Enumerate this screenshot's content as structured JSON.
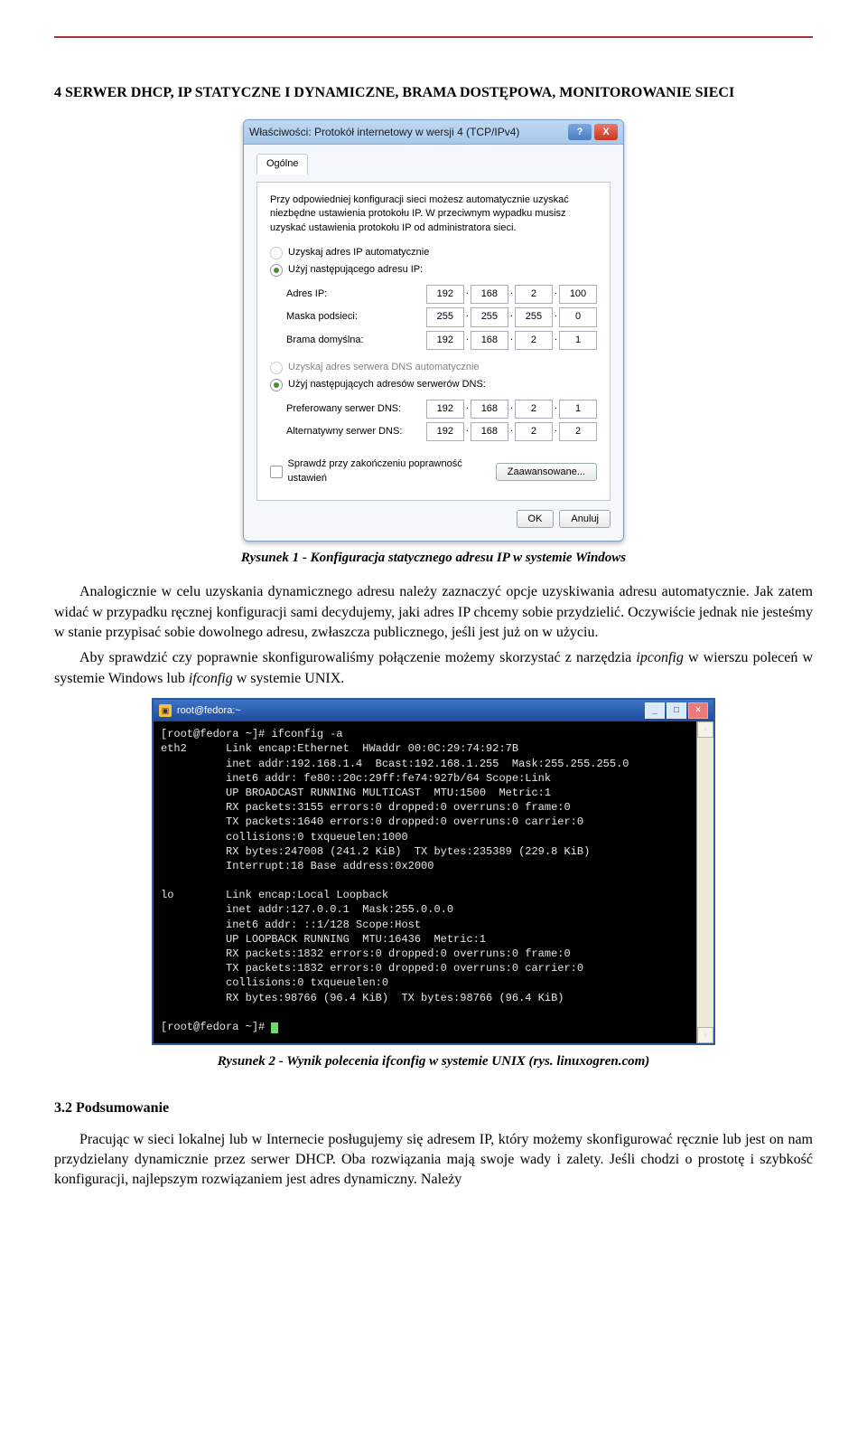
{
  "header_rule": true,
  "section_heading": "4   SERWER DHCP, IP STATYCZNE I DYNAMICZNE, BRAMA DOSTĘPOWA, MONITOROWANIE SIECI",
  "dialog": {
    "title": "Właściwości: Protokół internetowy w wersji 4 (TCP/IPv4)",
    "help_icon": "?",
    "close_icon": "X",
    "tab_label": "Ogólne",
    "description": "Przy odpowiedniej konfiguracji sieci możesz automatycznie uzyskać niezbędne ustawienia protokołu IP. W przeciwnym wypadku musisz uzyskać ustawienia protokołu IP od administratora sieci.",
    "radio_ip_auto": "Uzyskaj adres IP automatycznie",
    "radio_ip_manual": "Użyj następującego adresu IP:",
    "label_ip": "Adres IP:",
    "ip": [
      "192",
      "168",
      "2",
      "100"
    ],
    "label_mask": "Maska podsieci:",
    "mask": [
      "255",
      "255",
      "255",
      "0"
    ],
    "label_gateway": "Brama domyślna:",
    "gateway": [
      "192",
      "168",
      "2",
      "1"
    ],
    "radio_dns_auto": "Uzyskaj adres serwera DNS automatycznie",
    "radio_dns_manual": "Użyj następujących adresów serwerów DNS:",
    "label_dns_pref": "Preferowany serwer DNS:",
    "dns_pref": [
      "192",
      "168",
      "2",
      "1"
    ],
    "label_dns_alt": "Alternatywny serwer DNS:",
    "dns_alt": [
      "192",
      "168",
      "2",
      "2"
    ],
    "check_validate": "Sprawdź przy zakończeniu poprawność ustawień",
    "btn_advanced": "Zaawansowane...",
    "btn_ok": "OK",
    "btn_cancel": "Anuluj"
  },
  "fig1_caption": "Rysunek 1 - Konfiguracja statycznego adresu IP w systemie Windows",
  "para1": "Analogicznie w celu uzyskania dynamicznego adresu należy zaznaczyć opcje uzyskiwania adresu automatycznie. Jak zatem widać w przypadku ręcznej konfiguracji sami decydujemy, jaki adres IP chcemy sobie przydzielić. Oczywiście jednak nie jesteśmy w stanie przypisać sobie dowolnego adresu, zwłaszcza publicznego, jeśli jest już on w użyciu.",
  "para2_pre": "Aby sprawdzić czy poprawnie skonfigurowaliśmy połączenie możemy skorzystać z narzędzia ",
  "para2_em1": "ipconfig",
  "para2_mid": " w wierszu poleceń w systemie Windows lub ",
  "para2_em2": "ifconfig",
  "para2_post": " w systemie UNIX.",
  "terminal": {
    "title": "root@fedora:~",
    "lines": "[root@fedora ~]# ifconfig -a\neth2      Link encap:Ethernet  HWaddr 00:0C:29:74:92:7B\n          inet addr:192.168.1.4  Bcast:192.168.1.255  Mask:255.255.255.0\n          inet6 addr: fe80::20c:29ff:fe74:927b/64 Scope:Link\n          UP BROADCAST RUNNING MULTICAST  MTU:1500  Metric:1\n          RX packets:3155 errors:0 dropped:0 overruns:0 frame:0\n          TX packets:1640 errors:0 dropped:0 overruns:0 carrier:0\n          collisions:0 txqueuelen:1000\n          RX bytes:247008 (241.2 KiB)  TX bytes:235389 (229.8 KiB)\n          Interrupt:18 Base address:0x2000\n\nlo        Link encap:Local Loopback\n          inet addr:127.0.0.1  Mask:255.0.0.0\n          inet6 addr: ::1/128 Scope:Host\n          UP LOOPBACK RUNNING  MTU:16436  Metric:1\n          RX packets:1832 errors:0 dropped:0 overruns:0 frame:0\n          TX packets:1832 errors:0 dropped:0 overruns:0 carrier:0\n          collisions:0 txqueuelen:0\n          RX bytes:98766 (96.4 KiB)  TX bytes:98766 (96.4 KiB)\n\n[root@fedora ~]# "
  },
  "fig2_caption": "Rysunek 2 - Wynik polecenia ifconfig w systemie UNIX (rys. linuxogren.com)",
  "sub_heading": "3.2 Podsumowanie",
  "para3": "Pracując w sieci lokalnej lub w Internecie posługujemy się adresem IP, który możemy skonfigurować ręcznie lub jest on nam przydzielany dynamicznie przez serwer DHCP. Oba rozwiązania mają swoje wady i zalety. Jeśli chodzi o prostotę i szybkość konfiguracji, najlepszym rozwiązaniem jest adres dynamiczny. Należy"
}
